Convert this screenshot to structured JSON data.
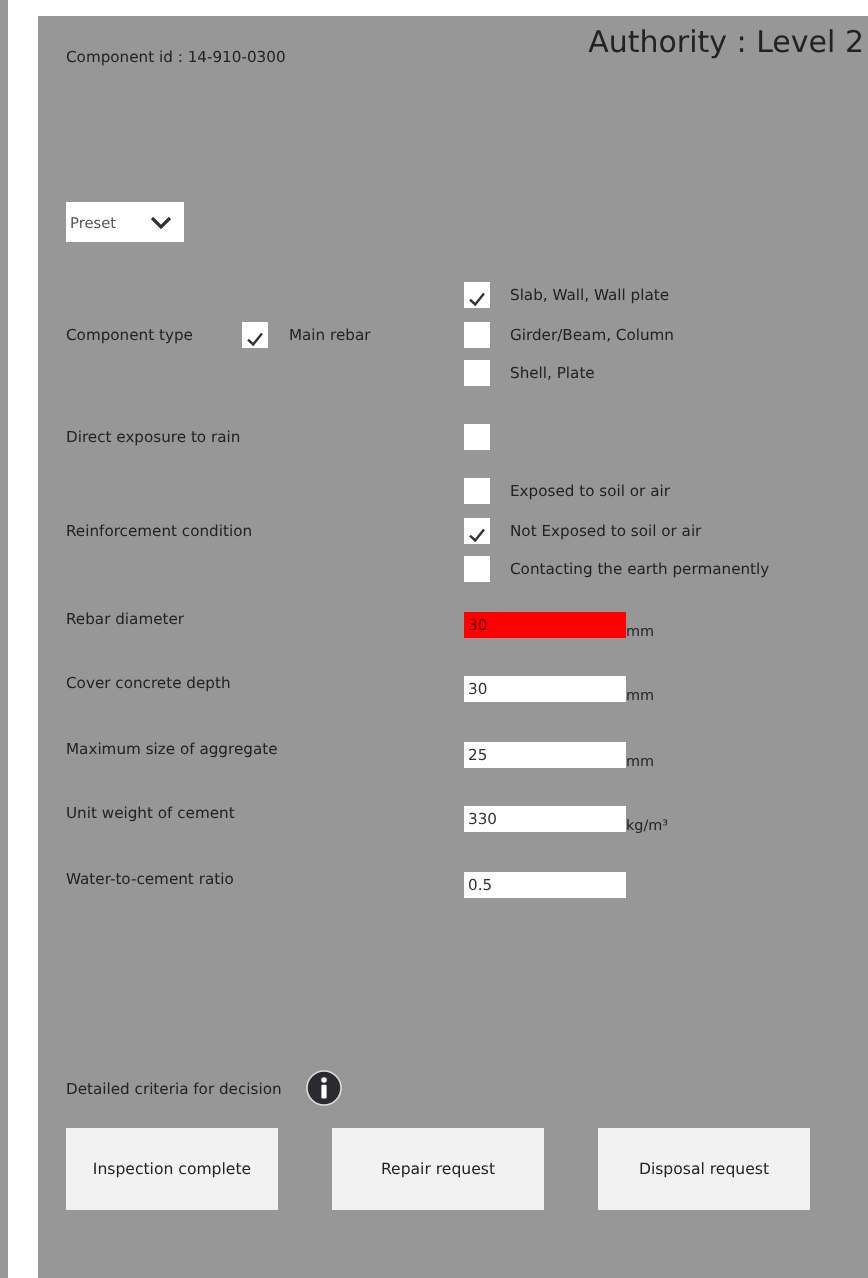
{
  "component_id": "Component id : 14-910-0300",
  "authority": "Authority : Level 2",
  "preset": {
    "value": "Preset"
  },
  "rows": [
    {
      "kind": "options",
      "label": "Component type",
      "inline": {
        "label": "Main rebar",
        "checked": true
      },
      "options": [
        {
          "label": "Slab, Wall, Wall plate",
          "checked": true
        },
        {
          "label": "Girder/Beam, Column",
          "checked": false
        },
        {
          "label": "Shell, Plate",
          "checked": false
        }
      ]
    },
    {
      "kind": "checkbox",
      "label": "Direct exposure to rain",
      "checked": false
    },
    {
      "kind": "options",
      "label": "Reinforcement condition",
      "options": [
        {
          "label": "Exposed to soil or air",
          "checked": false
        },
        {
          "label": "Not Exposed to soil or air",
          "checked": true
        },
        {
          "label": "Contacting the earth permanently",
          "checked": false
        }
      ]
    },
    {
      "kind": "field",
      "label": "Rebar diameter",
      "value": "30",
      "unit": "mm",
      "invalid": true
    },
    {
      "kind": "field",
      "label": "Cover concrete depth",
      "value": "30",
      "unit": "mm",
      "invalid": false
    },
    {
      "kind": "field",
      "label": "Maximum size of aggregate",
      "value": "25",
      "unit": "mm",
      "invalid": false
    },
    {
      "kind": "field",
      "label": "Unit weight of cement",
      "value": "330",
      "unit": "kg/m³",
      "invalid": false
    },
    {
      "kind": "field",
      "label": "Water-to-cement ratio",
      "value": "0.5",
      "invalid": false
    }
  ],
  "criteria_label": "Detailed criteria for decision",
  "buttons": [
    "Inspection complete",
    "Repair request",
    "Disposal request"
  ]
}
